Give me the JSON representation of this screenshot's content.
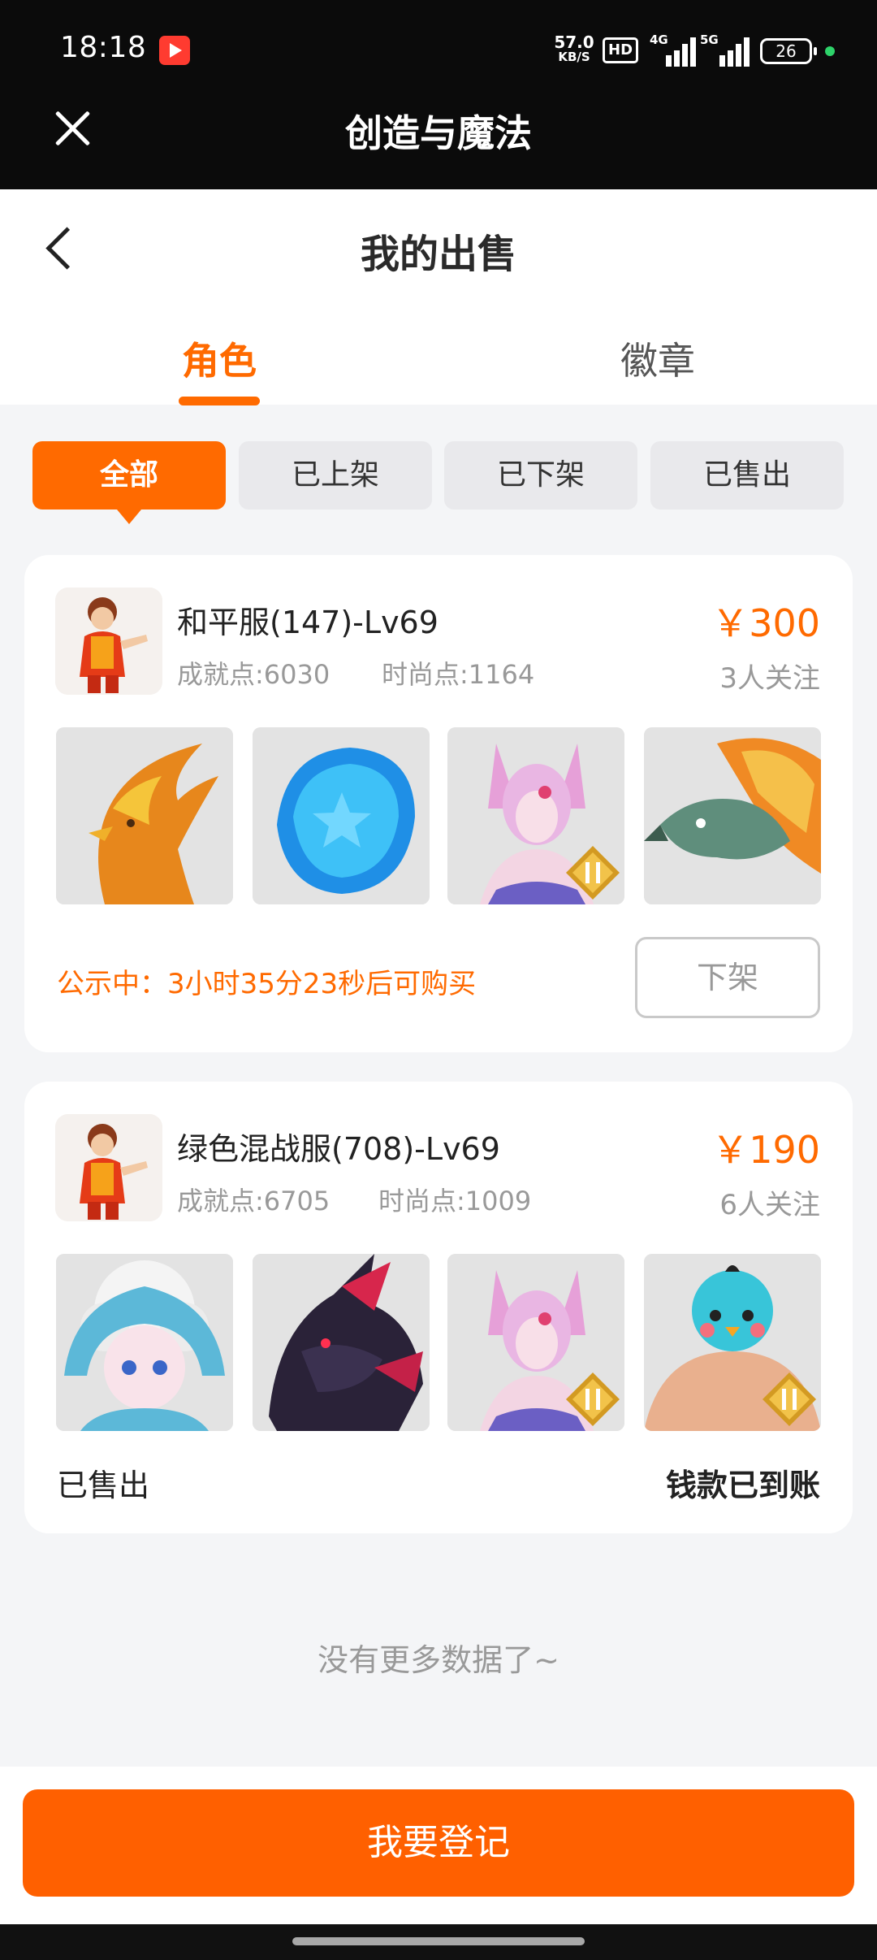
{
  "status_bar": {
    "time": "18:18",
    "net_speed": "57.0",
    "net_unit": "KB/S",
    "hd": "HD",
    "signal1": "4G",
    "signal2": "5G",
    "battery": "26"
  },
  "app": {
    "title": "创造与魔法"
  },
  "page": {
    "title": "我的出售"
  },
  "tabs": [
    {
      "label": "角色",
      "active": true
    },
    {
      "label": "徽章",
      "active": false
    }
  ],
  "filters": [
    {
      "label": "全部",
      "active": true
    },
    {
      "label": "已上架",
      "active": false
    },
    {
      "label": "已下架",
      "active": false
    },
    {
      "label": "已售出",
      "active": false
    }
  ],
  "listings": [
    {
      "name": "和平服(147)-Lv69",
      "achievement": "成就点:6030",
      "fashion": "时尚点:1164",
      "price": "￥300",
      "followers": "3人关注",
      "status_text": "公示中：3小时35分23秒后可购买",
      "action_label": "下架"
    },
    {
      "name": "绿色混战服(708)-Lv69",
      "achievement": "成就点:6705",
      "fashion": "时尚点:1009",
      "price": "￥190",
      "followers": "6人关注",
      "status_text": "已售出",
      "settlement": "钱款已到账"
    }
  ],
  "footer": {
    "no_more": "没有更多数据了~",
    "register_label": "我要登记"
  },
  "colors": {
    "accent": "#ff6a00",
    "muted": "#999999",
    "background": "#f4f5f7"
  },
  "icons": [
    "close-icon",
    "back-arrow-icon",
    "record-icon",
    "battery-icon",
    "rank-badge-icon"
  ]
}
